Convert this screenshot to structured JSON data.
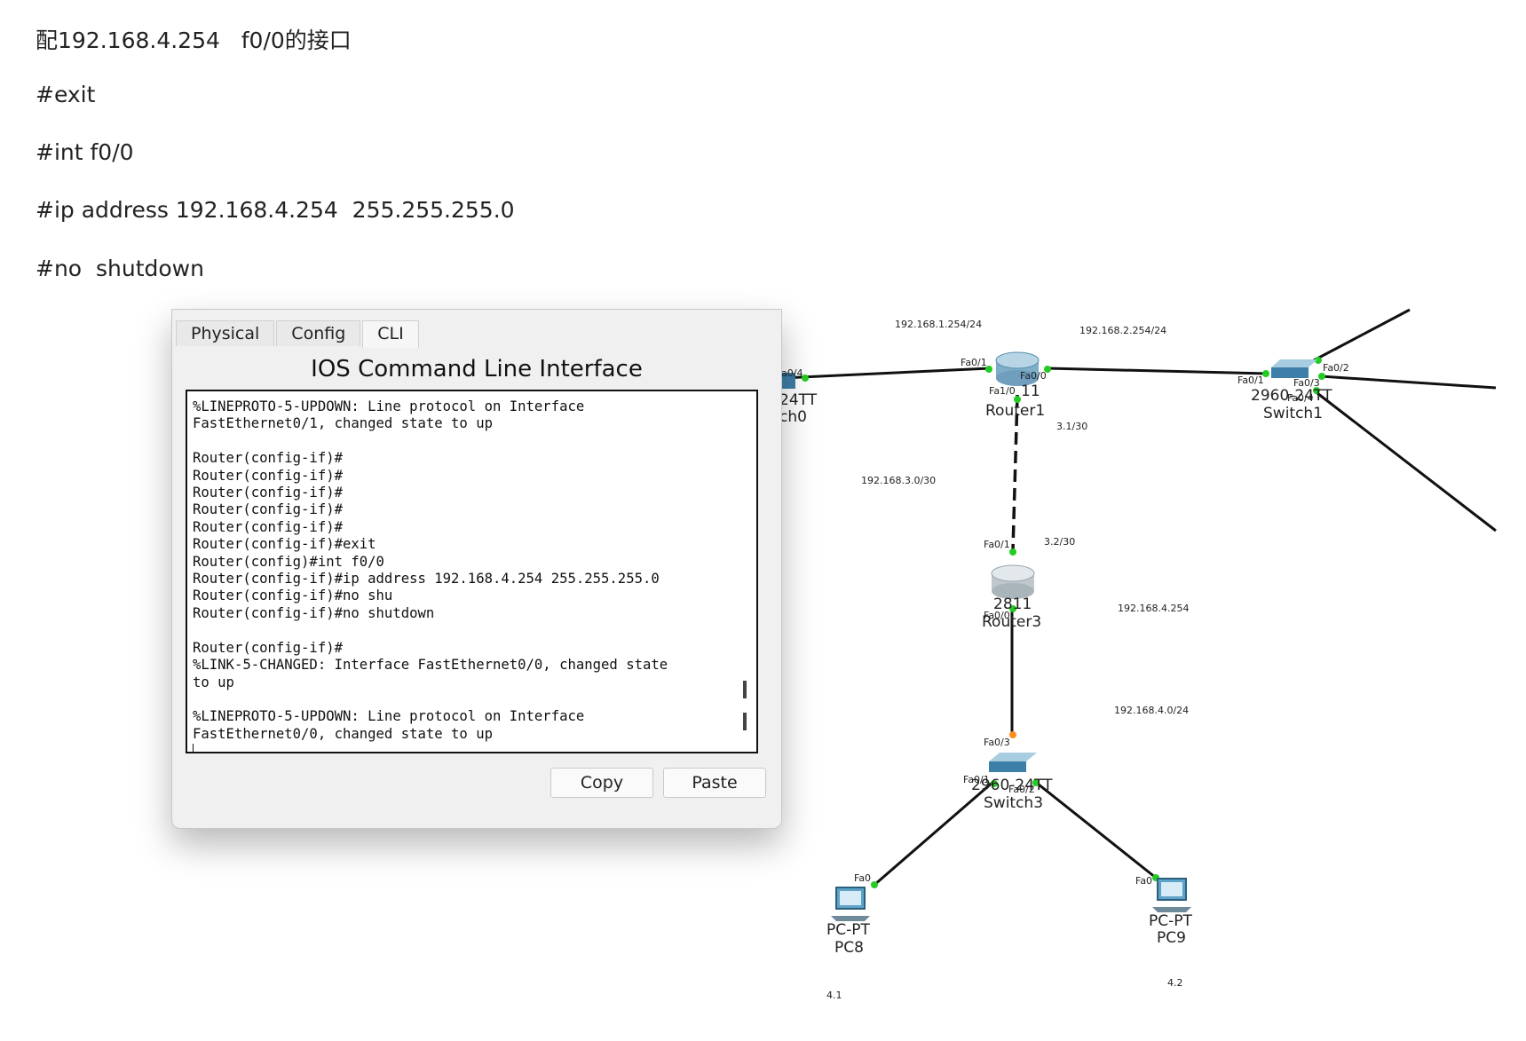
{
  "article": {
    "line1": "配192.168.4.254   f0/0的接口",
    "line2": "#exit",
    "line3": "#int f0/0",
    "line4": "#ip address 192.168.4.254  255.255.255.0",
    "line5": "#no  shutdown"
  },
  "cli_window": {
    "tabs": [
      "Physical",
      "Config",
      "CLI"
    ],
    "active_tab": "CLI",
    "heading": "IOS Command Line Interface",
    "terminal_lines": [
      "%LINEPROTO-5-UPDOWN: Line protocol on Interface",
      "FastEthernet0/1, changed state to up",
      "",
      "Router(config-if)#",
      "Router(config-if)#",
      "Router(config-if)#",
      "Router(config-if)#",
      "Router(config-if)#",
      "Router(config-if)#exit",
      "Router(config)#int f0/0",
      "Router(config-if)#ip address 192.168.4.254 255.255.255.0",
      "Router(config-if)#no shu",
      "Router(config-if)#no shutdown",
      "",
      "Router(config-if)#",
      "%LINK-5-CHANGED: Interface FastEthernet0/0, changed state",
      "to up",
      "",
      "%LINEPROTO-5-UPDOWN: Line protocol on Interface",
      "FastEthernet0/0, changed state to up"
    ],
    "copy_label": "Copy",
    "paste_label": "Paste"
  },
  "topology": {
    "net_labels": {
      "n1": "192.168.1.254/24",
      "n2": "192.168.2.254/24",
      "n3": "192.168.3.0/30",
      "n4": "3.1/30",
      "n5": "3.2/30",
      "n6": "192.168.4.254",
      "n7": "192.168.4.0/24",
      "n8": "4.1",
      "n9": "4.2"
    },
    "switch0": {
      "model": "24TT",
      "name": "ch0",
      "port": "a0/4"
    },
    "router1": {
      "model": "11",
      "name": "Router1",
      "ports": [
        "Fa0/1",
        "Fa0/0",
        "Fa1/0"
      ]
    },
    "switch1": {
      "model": "2960-24TT",
      "name": "Switch1",
      "ports": [
        "Fa0/1",
        "Fa0/2",
        "Fa0/3",
        "Fa0/4"
      ]
    },
    "router3": {
      "model": "2811",
      "name": "Router3",
      "ports": [
        "Fa0/1",
        "Fa0/0"
      ]
    },
    "switch3": {
      "model": "2960-24TT",
      "name": "Switch3",
      "ports": [
        "Fa0/3",
        "Fa0/1",
        "Fa0/2"
      ]
    },
    "pc8": {
      "model": "PC-PT",
      "name": "PC8",
      "port": "Fa0"
    },
    "pc9": {
      "model": "PC-PT",
      "name": "PC9",
      "port": "Fa0"
    }
  },
  "colors": {
    "link_up": "#22cc22",
    "link_pending": "#ff8c1a",
    "device_blue": "#3d7fa8"
  }
}
